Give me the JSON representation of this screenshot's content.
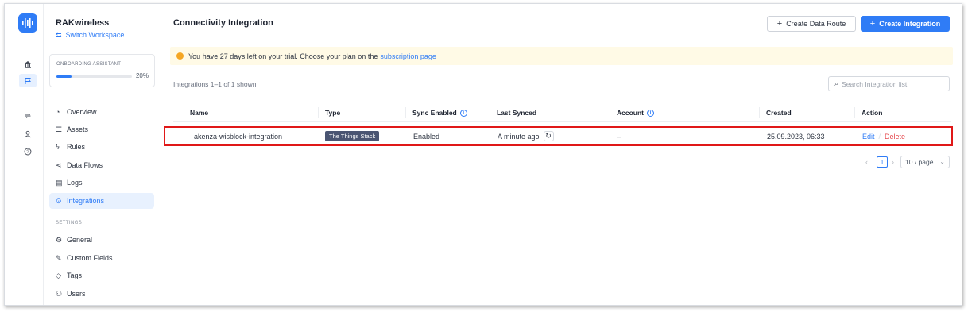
{
  "workspace": {
    "name": "RAKwireless",
    "switch_label": "Switch Workspace"
  },
  "onboarding": {
    "title": "ONBOARDING ASSISTANT",
    "percent_label": "20%",
    "progress": 0.2
  },
  "nav": {
    "items": [
      {
        "label": "Overview",
        "icon": "dashboard-icon"
      },
      {
        "label": "Assets",
        "icon": "list-icon"
      },
      {
        "label": "Rules",
        "icon": "bolt-icon"
      },
      {
        "label": "Data Flows",
        "icon": "share-icon"
      },
      {
        "label": "Logs",
        "icon": "log-icon"
      },
      {
        "label": "Integrations",
        "icon": "integration-icon",
        "active": true
      }
    ],
    "settings_label": "SETTINGS",
    "settings_items": [
      {
        "label": "General",
        "icon": "gear-icon"
      },
      {
        "label": "Custom Fields",
        "icon": "edit-icon"
      },
      {
        "label": "Tags",
        "icon": "tag-icon"
      },
      {
        "label": "Users",
        "icon": "users-icon"
      }
    ]
  },
  "header": {
    "title": "Connectivity Integration",
    "create_route_label": "Create Data Route",
    "create_integration_label": "Create Integration"
  },
  "banner": {
    "text": "You have 27 days left on your trial. Choose your plan on the",
    "link": "subscription page"
  },
  "list": {
    "count_text": "Integrations 1–1 of 1 shown",
    "search_placeholder": "Search Integration list",
    "columns": [
      "Name",
      "Type",
      "Sync Enabled",
      "Last Synced",
      "Account",
      "Created",
      "Action"
    ],
    "rows": [
      {
        "name": "akenza-wisblock-integration",
        "type": "The Things Stack",
        "sync_enabled": "Enabled",
        "last_synced": "A minute ago",
        "account": "–",
        "created": "25.09.2023, 06:33",
        "edit": "Edit",
        "delete": "Delete"
      }
    ]
  },
  "pagination": {
    "current_page": "1",
    "page_size": "10 / page"
  },
  "colors": {
    "accent": "#2f7cf6",
    "highlight_border": "#e01818",
    "delete": "#e5484d",
    "tag_bg": "#4a5572"
  }
}
